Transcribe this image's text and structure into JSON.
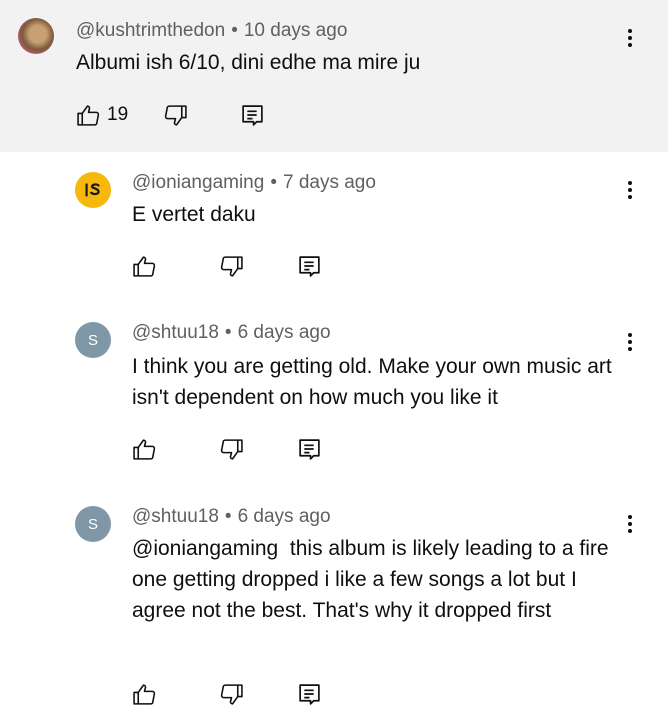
{
  "comments": [
    {
      "avatar": "photo-avatar",
      "handle": "@kushtrimthedon",
      "separator": "•",
      "time": "10 days ago",
      "text": "Albumi ish 6/10, dini edhe ma mire ju",
      "likes": "19",
      "highlighted": true
    },
    {
      "avatar": "ioniangaming-logo",
      "handle": "@ioniangaming",
      "separator": "•",
      "time": "7 days ago",
      "text": "E vertet daku",
      "likes": ""
    },
    {
      "avatar_letter": "S",
      "handle": "@shtuu18",
      "separator": "•",
      "time": "6 days ago",
      "text": "I think you are getting old. Make your own music art isn't dependent on how much you like it",
      "likes": ""
    },
    {
      "avatar_letter": "S",
      "handle": "@shtuu18",
      "separator": "•",
      "time": "6 days ago",
      "text": "@ioniangaming  this album is likely leading to a fire one getting dropped i like a few songs a lot but I agree not the best. That's why it dropped first",
      "likes": ""
    }
  ],
  "icons": [
    "thumb-up-icon",
    "thumb-down-icon",
    "reply-icon",
    "more-vertical-icon"
  ],
  "colors": {
    "highlight_bg": "#f2f2f2",
    "meta_text": "#606060",
    "avatar_s": "#7f97a6",
    "brand_yellow": "#f6b80b"
  }
}
